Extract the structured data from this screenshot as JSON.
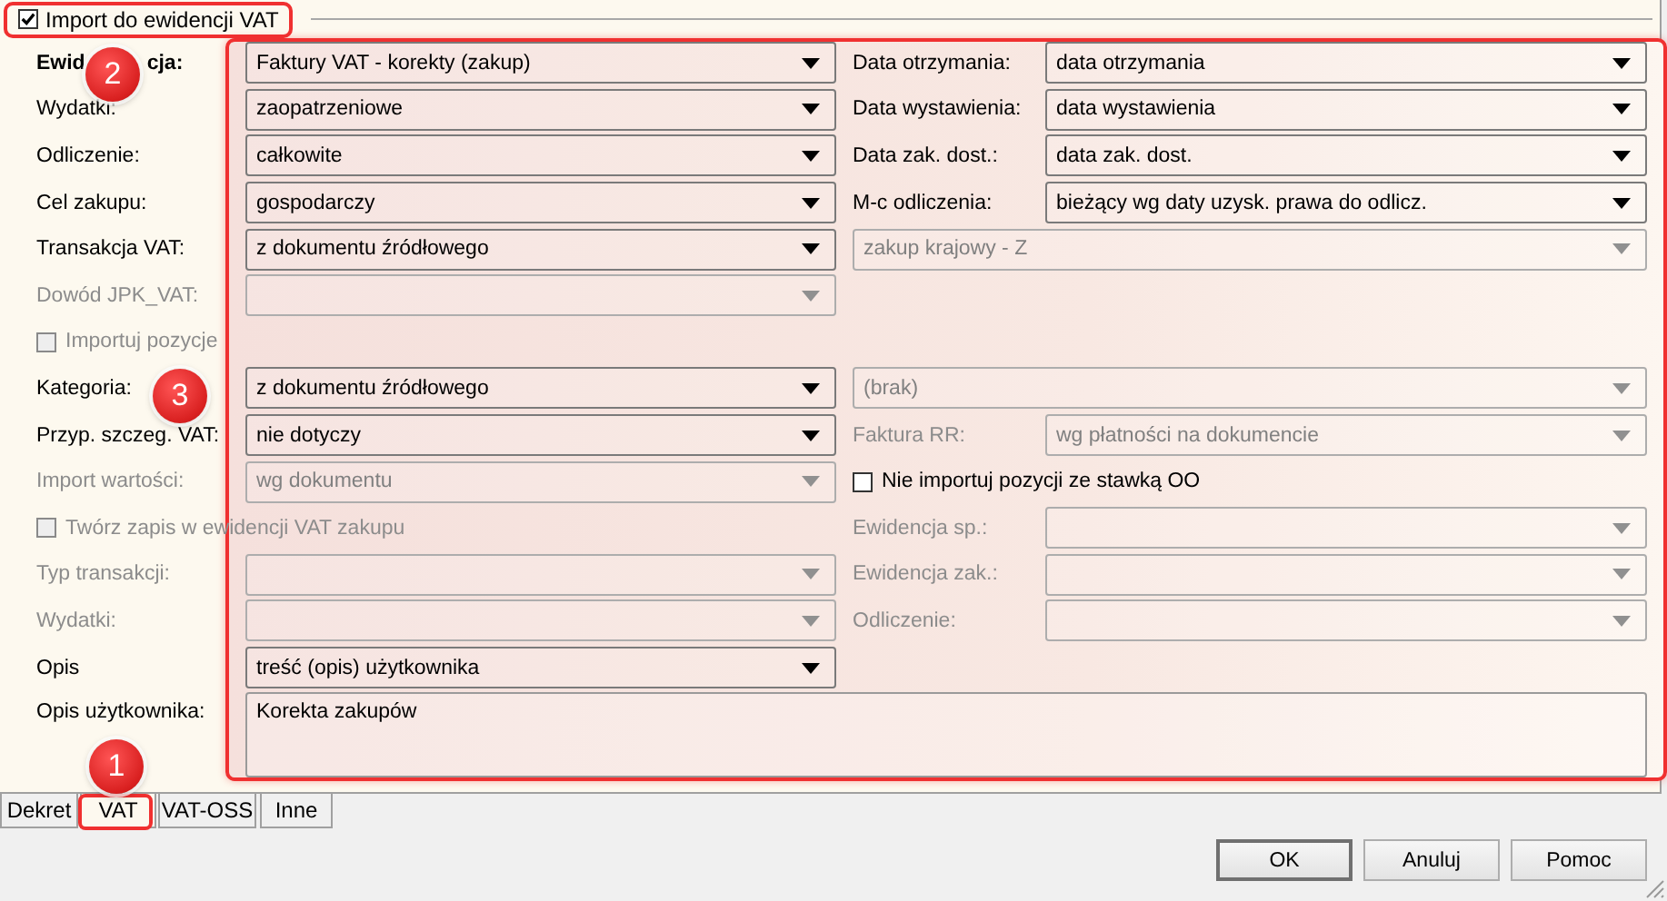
{
  "header": {
    "label": "Import do ewidencji VAT",
    "checked": true
  },
  "rows": [
    {
      "left": {
        "kind": "combo",
        "label": [
          "Ewid",
          "cja:"
        ],
        "bold": true,
        "value": "Faktury VAT - korekty (zakup)",
        "disabled": false
      },
      "right": {
        "kind": "combo",
        "label": "Data otrzymania:",
        "value": "data otrzymania",
        "disabled": false
      }
    },
    {
      "left": {
        "kind": "combo",
        "label": "Wydatki:",
        "bold": false,
        "value": "zaopatrzeniowe",
        "disabled": false
      },
      "right": {
        "kind": "combo",
        "label": "Data wystawienia:",
        "value": "data wystawienia",
        "disabled": false
      }
    },
    {
      "left": {
        "kind": "combo",
        "label": "Odliczenie:",
        "bold": false,
        "value": "całkowite",
        "disabled": false
      },
      "right": {
        "kind": "combo",
        "label": "Data zak. dost.:",
        "value": "data zak. dost.",
        "disabled": false
      }
    },
    {
      "left": {
        "kind": "combo",
        "label": "Cel zakupu:",
        "bold": false,
        "value": "gospodarczy",
        "disabled": false
      },
      "right": {
        "kind": "combo",
        "label": "M-c odliczenia:",
        "value": "bieżący wg daty uzysk. prawa do odlicz.",
        "disabled": false
      }
    },
    {
      "left": {
        "kind": "combo",
        "label": "Transakcja VAT:",
        "bold": false,
        "value": "z dokumentu źródłowego",
        "disabled": false
      },
      "right": {
        "kind": "wide-combo",
        "value": "zakup krajowy - Z",
        "disabled": true
      }
    },
    {
      "left": {
        "kind": "combo",
        "label": "Dowód JPK_VAT:",
        "bold": false,
        "disabled": true
      }
    },
    {
      "left": {
        "kind": "checkbox",
        "label": "Importuj pozycje",
        "checked": false,
        "disabled": true
      }
    },
    {
      "left": {
        "kind": "combo",
        "label": "Kategoria:",
        "bold": false,
        "value": "z dokumentu źródłowego",
        "disabled": false
      },
      "right": {
        "kind": "wide-combo",
        "value": "(brak)",
        "disabled": true
      }
    },
    {
      "left": {
        "kind": "combo",
        "label": "Przyp. szczeg. VAT:",
        "bold": false,
        "value": "nie dotyczy",
        "disabled": false
      },
      "right": {
        "kind": "combo",
        "label": "Faktura RR:",
        "value": "wg płatności na dokumencie",
        "disabled": true
      }
    },
    {
      "left": {
        "kind": "combo",
        "label": "Import wartości:",
        "bold": false,
        "value": "wg dokumentu",
        "disabled": true
      },
      "right": {
        "kind": "checkbox",
        "label": "Nie importuj pozycji ze stawką OO",
        "checked": false,
        "disabled": false
      }
    },
    {
      "left": {
        "kind": "checkbox",
        "label": "Twórz zapis w ewidencji VAT zakupu",
        "checked": false,
        "disabled": true
      },
      "right": {
        "kind": "combo",
        "label": "Ewidencja sp.:",
        "disabled": true
      }
    },
    {
      "left": {
        "kind": "combo",
        "label": "Typ transakcji:",
        "bold": false,
        "disabled": true
      },
      "right": {
        "kind": "combo",
        "label": "Ewidencja zak.:",
        "disabled": true
      }
    },
    {
      "left": {
        "kind": "combo",
        "label": "Wydatki:",
        "bold": false,
        "disabled": true
      },
      "right": {
        "kind": "combo",
        "label": "Odliczenie:",
        "disabled": true
      }
    },
    {
      "left": {
        "kind": "combo",
        "label": "Opis",
        "bold": false,
        "value": "treść (opis) użytkownika",
        "disabled": false
      }
    },
    {
      "left": {
        "kind": "textarea",
        "label": "Opis użytkownika:",
        "bold": false,
        "value": "Korekta zakupów",
        "disabled": false
      }
    }
  ],
  "tabs": [
    {
      "label": "Dekret",
      "selected": false
    },
    {
      "label": "VAT",
      "selected": true
    },
    {
      "label": "VAT-OSS",
      "selected": false
    },
    {
      "label": "Inne",
      "selected": false
    }
  ],
  "buttons": [
    {
      "label": "OK",
      "default": true
    },
    {
      "label": "Anuluj",
      "default": false
    },
    {
      "label": "Pomoc",
      "default": false
    }
  ],
  "callouts": [
    {
      "label": "1"
    },
    {
      "label": "2"
    },
    {
      "label": "3"
    }
  ]
}
